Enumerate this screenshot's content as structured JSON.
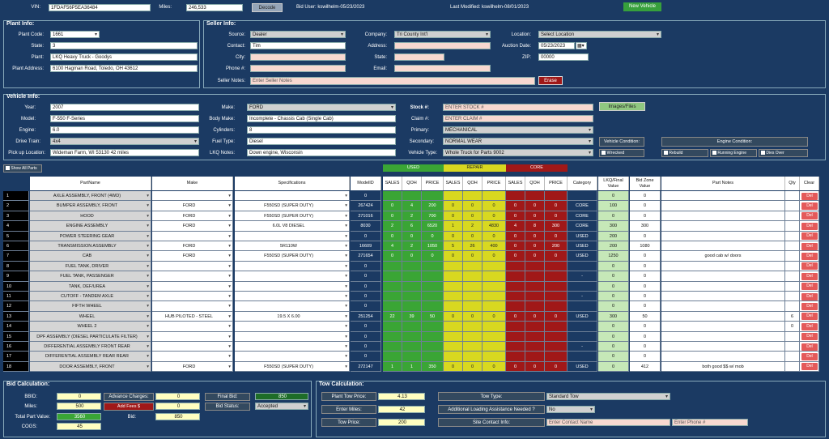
{
  "topbar": {
    "vin_label": "VIN:",
    "vin_value": "1FDAF56P5EA36484",
    "miles_label": "Miles:",
    "miles_value": "246,533",
    "decode_label": "Decode",
    "bid_user": "Bid User: kswilhelm-05/23/2023",
    "last_modified": "Last Modified: kswilhelm-08/01/2023",
    "new_vehicle_label": "New Vehicle"
  },
  "plant": {
    "title": "Plant Info:",
    "code_label": "Plant Code:",
    "code_value": "1661",
    "state_label": "State:",
    "state_value": "3",
    "plant_label": "Plant:",
    "plant_value": "LKQ Heavy Truck - Goodys",
    "address_label": "Plant Address:",
    "address_value": "6100 Hagman Road, Toledo, OH 43612"
  },
  "seller": {
    "title": "Seller Info:",
    "source_label": "Source:",
    "source_value": "Dealer",
    "contact_label": "Contact:",
    "contact_value": "Tim",
    "city_label": "City:",
    "state_label": "State:",
    "phone_label": "Phone #:",
    "email_label": "Email:",
    "company_label": "Company:",
    "company_value": "Tri County Int'l",
    "address_label": "Address:",
    "location_label": "Location:",
    "location_value": "Select Location",
    "auction_label": "Auction Date:",
    "auction_value": "05/23/2023",
    "zip_label": "ZIP:",
    "zip_value": "00000",
    "notes_label": "Seller Notes:",
    "notes_placeholder": "Enter Seller Notes",
    "erase_label": "Erase"
  },
  "vehicle": {
    "title": "Vehicle Info:",
    "year_label": "Year:",
    "year_value": "2007",
    "model_label": "Model:",
    "model_value": "F-550 F-Series",
    "engine_label": "Engine:",
    "engine_value": "6.0",
    "drive_label": "Drive Train:",
    "drive_value": "4x4",
    "pickup_label": "Pick up Location:",
    "pickup_value": "Wideman Farm, WI 53130 42 miles",
    "make_label": "Make:",
    "make_value": "FORD",
    "body_label": "Body Make:",
    "body_value": "Incomplete - Chassis Cab (Single Cab)",
    "cyl_label": "Cylinders:",
    "cyl_value": "8",
    "fuel_label": "Fuel Type:",
    "fuel_value": "Diesel",
    "notes_label": "LKQ Notes:",
    "notes_value": "Down engine, Wisconsin",
    "stock_label": "Stock #:",
    "stock_value": "ENTER STOCK #",
    "claim_label": "Claim #:",
    "claim_value": "ENTER CLAIM #",
    "primary_label": "Primary:",
    "primary_value": "MECHANICAL",
    "secondary_label": "Secondary:",
    "secondary_value": "NORMAL WEAR",
    "vtype_label": "Vehicle Type:",
    "vtype_value": "Whole Truck for Parts 9002",
    "images_label": "Images/Files",
    "vcond_label": "Vehicle Condition:",
    "vcond_opt1": "Wrecked",
    "econd_label": "Engine Condition:",
    "econd_opts": [
      "Rebuild",
      "Running Engine",
      "Dies Over"
    ]
  },
  "grid": {
    "show_all_label": "Show All Parts",
    "legend": [
      {
        "label": "USED",
        "color": "#3aa535"
      },
      {
        "label": "REPAIR",
        "color": "#d8d820"
      },
      {
        "label": "CORE",
        "color": "#a01818"
      }
    ],
    "headers": [
      "PartName",
      "Make",
      "Specifications",
      "ModelID",
      "SALES",
      "QOH",
      "PRICE",
      "SALES",
      "QOH",
      "PRICE",
      "SALES",
      "QOH",
      "PRICE",
      "Category",
      "LKQ/Final Value",
      "Bid Zone Value",
      "Part Notes",
      "Qty",
      "Clear"
    ],
    "del_label": "Del",
    "rows": [
      {
        "n": "1",
        "part": "AXLE ASSEMBLY, FRONT (4WD)",
        "make": "",
        "spec": "",
        "mid": "0",
        "s1": "",
        "q1": "",
        "p1": "",
        "s2": "",
        "q2": "",
        "p2": "",
        "s3": "",
        "q3": "",
        "p3": "",
        "cat": "",
        "lkq": "0",
        "bz": "0",
        "notes": "",
        "qty": ""
      },
      {
        "n": "2",
        "part": "BUMPER ASSEMBLY, FRONT",
        "make": "FORD",
        "spec": "F550SD (SUPER DUTY)",
        "mid": "267424",
        "s1": "0",
        "q1": "4",
        "p1": "200",
        "s2": "0",
        "q2": "0",
        "p2": "0",
        "s3": "0",
        "q3": "0",
        "p3": "0",
        "cat": "CORE",
        "lkq": "100",
        "bz": "0",
        "notes": "",
        "qty": ""
      },
      {
        "n": "3",
        "part": "HOOD",
        "make": "FORD",
        "spec": "F550SD (SUPER DUTY)",
        "mid": "271016",
        "s1": "0",
        "q1": "2",
        "p1": "700",
        "s2": "0",
        "q2": "0",
        "p2": "0",
        "s3": "0",
        "q3": "0",
        "p3": "0",
        "cat": "CORE",
        "lkq": "0",
        "bz": "0",
        "notes": "",
        "qty": ""
      },
      {
        "n": "4",
        "part": "ENGINE ASSEMBLY",
        "make": "FORD",
        "spec": "6.0L V8 DIESEL",
        "mid": "8030",
        "s1": "2",
        "q1": "6",
        "p1": "6520",
        "s2": "1",
        "q2": "2",
        "p2": "4830",
        "s3": "4",
        "q3": "8",
        "p3": "300",
        "cat": "CORE",
        "lkq": "300",
        "bz": "300",
        "notes": "",
        "qty": ""
      },
      {
        "n": "5",
        "part": "POWER STEERING GEAR",
        "make": "",
        "spec": "",
        "mid": "0",
        "s1": "0",
        "q1": "0",
        "p1": "0",
        "s2": "0",
        "q2": "0",
        "p2": "0",
        "s3": "0",
        "q3": "0",
        "p3": "0",
        "cat": "USED",
        "lkq": "200",
        "bz": "0",
        "notes": "",
        "qty": ""
      },
      {
        "n": "6",
        "part": "TRANSMISSION ASSEMBLY",
        "make": "FORD",
        "spec": "5R110W",
        "mid": "16609",
        "s1": "4",
        "q1": "2",
        "p1": "1050",
        "s2": "5",
        "q2": "26",
        "p2": "400",
        "s3": "0",
        "q3": "0",
        "p3": "200",
        "cat": "USED",
        "lkq": "200",
        "bz": "1080",
        "notes": "",
        "qty": ""
      },
      {
        "n": "7",
        "part": "CAB",
        "make": "FORD",
        "spec": "F550SD (SUPER DUTY)",
        "mid": "271654",
        "s1": "0",
        "q1": "0",
        "p1": "0",
        "s2": "0",
        "q2": "0",
        "p2": "0",
        "s3": "0",
        "q3": "0",
        "p3": "0",
        "cat": "USED",
        "lkq": "1250",
        "bz": "0",
        "notes": "good cab w/ doors",
        "qty": ""
      },
      {
        "n": "8",
        "part": "FUEL TANK, DRIVER",
        "make": "",
        "spec": "",
        "mid": "0",
        "s1": "",
        "q1": "",
        "p1": "",
        "s2": "",
        "q2": "",
        "p2": "",
        "s3": "",
        "q3": "",
        "p3": "",
        "cat": "",
        "lkq": "0",
        "bz": "0",
        "notes": "",
        "qty": ""
      },
      {
        "n": "9",
        "part": "FUEL TANK, PASSENGER",
        "make": "",
        "spec": "",
        "mid": "0",
        "s1": "",
        "q1": "",
        "p1": "",
        "s2": "",
        "q2": "",
        "p2": "",
        "s3": "",
        "q3": "",
        "p3": "",
        "cat": "-",
        "lkq": "0",
        "bz": "0",
        "notes": "",
        "qty": ""
      },
      {
        "n": "10",
        "part": "TANK, DEF/UREA",
        "make": "",
        "spec": "",
        "mid": "0",
        "s1": "",
        "q1": "",
        "p1": "",
        "s2": "",
        "q2": "",
        "p2": "",
        "s3": "",
        "q3": "",
        "p3": "",
        "cat": "",
        "lkq": "0",
        "bz": "0",
        "notes": "",
        "qty": ""
      },
      {
        "n": "11",
        "part": "CUTOFF - TANDEM AXLE",
        "make": "",
        "spec": "",
        "mid": "0",
        "s1": "",
        "q1": "",
        "p1": "",
        "s2": "",
        "q2": "",
        "p2": "",
        "s3": "",
        "q3": "",
        "p3": "",
        "cat": "-",
        "lkq": "0",
        "bz": "0",
        "notes": "",
        "qty": ""
      },
      {
        "n": "12",
        "part": "FIFTH WHEEL",
        "make": "",
        "spec": "",
        "mid": "0",
        "s1": "",
        "q1": "",
        "p1": "",
        "s2": "",
        "q2": "",
        "p2": "",
        "s3": "",
        "q3": "",
        "p3": "",
        "cat": "",
        "lkq": "0",
        "bz": "0",
        "notes": "",
        "qty": ""
      },
      {
        "n": "13",
        "part": "WHEEL",
        "make": "HUB PILOTED - STEEL",
        "spec": "19.5 X 6.00",
        "mid": "251254",
        "s1": "22",
        "q1": "39",
        "p1": "50",
        "s2": "0",
        "q2": "0",
        "p2": "0",
        "s3": "0",
        "q3": "0",
        "p3": "0",
        "cat": "USED",
        "lkq": "300",
        "bz": "50",
        "notes": "",
        "qty": "6"
      },
      {
        "n": "14",
        "part": "WHEEL 2",
        "make": "",
        "spec": "",
        "mid": "0",
        "s1": "",
        "q1": "",
        "p1": "",
        "s2": "",
        "q2": "",
        "p2": "",
        "s3": "",
        "q3": "",
        "p3": "",
        "cat": "",
        "lkq": "0",
        "bz": "0",
        "notes": "",
        "qty": "0"
      },
      {
        "n": "15",
        "part": "DPF ASSEMBLY (DIESEL PARTICULATE FILTER)",
        "make": "",
        "spec": "",
        "mid": "0",
        "s1": "",
        "q1": "",
        "p1": "",
        "s2": "",
        "q2": "",
        "p2": "",
        "s3": "",
        "q3": "",
        "p3": "",
        "cat": "",
        "lkq": "0",
        "bz": "0",
        "notes": "",
        "qty": ""
      },
      {
        "n": "16",
        "part": "DIFFERENTIAL ASSEMBLY FRONT REAR",
        "make": "",
        "spec": "",
        "mid": "0",
        "s1": "",
        "q1": "",
        "p1": "",
        "s2": "",
        "q2": "",
        "p2": "",
        "s3": "",
        "q3": "",
        "p3": "",
        "cat": "-",
        "lkq": "0",
        "bz": "0",
        "notes": "",
        "qty": ""
      },
      {
        "n": "17",
        "part": "DIFFERENTIAL ASSEMBLY REAR REAR",
        "make": "",
        "spec": "",
        "mid": "0",
        "s1": "",
        "q1": "",
        "p1": "",
        "s2": "",
        "q2": "",
        "p2": "",
        "s3": "",
        "q3": "",
        "p3": "",
        "cat": "",
        "lkq": "0",
        "bz": "0",
        "notes": "",
        "qty": ""
      },
      {
        "n": "18",
        "part": "DOOR ASSEMBLY, FRONT",
        "make": "FORD",
        "spec": "F550SD (SUPER DUTY)",
        "mid": "272147",
        "s1": "1",
        "q1": "1",
        "p1": "350",
        "s2": "0",
        "q2": "0",
        "p2": "0",
        "s3": "0",
        "q3": "0",
        "p3": "0",
        "cat": "USED",
        "lkq": "0",
        "bz": "412",
        "notes": "both good $$ w/ mob",
        "qty": ""
      }
    ]
  },
  "bid": {
    "title": "Bid Calculation:",
    "bbid_label": "BBID:",
    "bbid_value": "0",
    "miles_label": "Miles:",
    "miles_value": "500",
    "total_label": "Total Part Value:",
    "total_value": "3560",
    "cogs_label": "COGS:",
    "cogs_value": "45",
    "adv_label": "Advance Charges:",
    "adv_value": "0",
    "add_fee_label": "Add Fees $",
    "add_fee_value": "0",
    "bid_label": "Bid:",
    "bid_value": "850",
    "final_label": "Final Bid:",
    "final_value": "850",
    "status_label": "Bid Status:",
    "status_value": "Accepted"
  },
  "tow": {
    "title": "Tow Calculation:",
    "plant_tow_label": "Plant Tow Price:",
    "plant_tow_value": "4.13",
    "enter_miles_label": "Enter Miles:",
    "enter_miles_value": "42",
    "tow_price_label": "Tow Price:",
    "tow_price_value": "200",
    "tow_type_label": "Tow Type:",
    "tow_type_value": "Standard Tow",
    "loading_label": "Additional Loading Assistance Needed ?",
    "loading_value": "No",
    "site_label": "Site Contact Info:",
    "site_name": "Enter Contact Name",
    "site_phone": "Enter Phone #"
  },
  "colors": {
    "background": "#1b3a63",
    "used": "#3aa535",
    "repair": "#d8d820",
    "core": "#a01818",
    "lkq": "#c6e8b8",
    "del": "#e45a5a"
  }
}
